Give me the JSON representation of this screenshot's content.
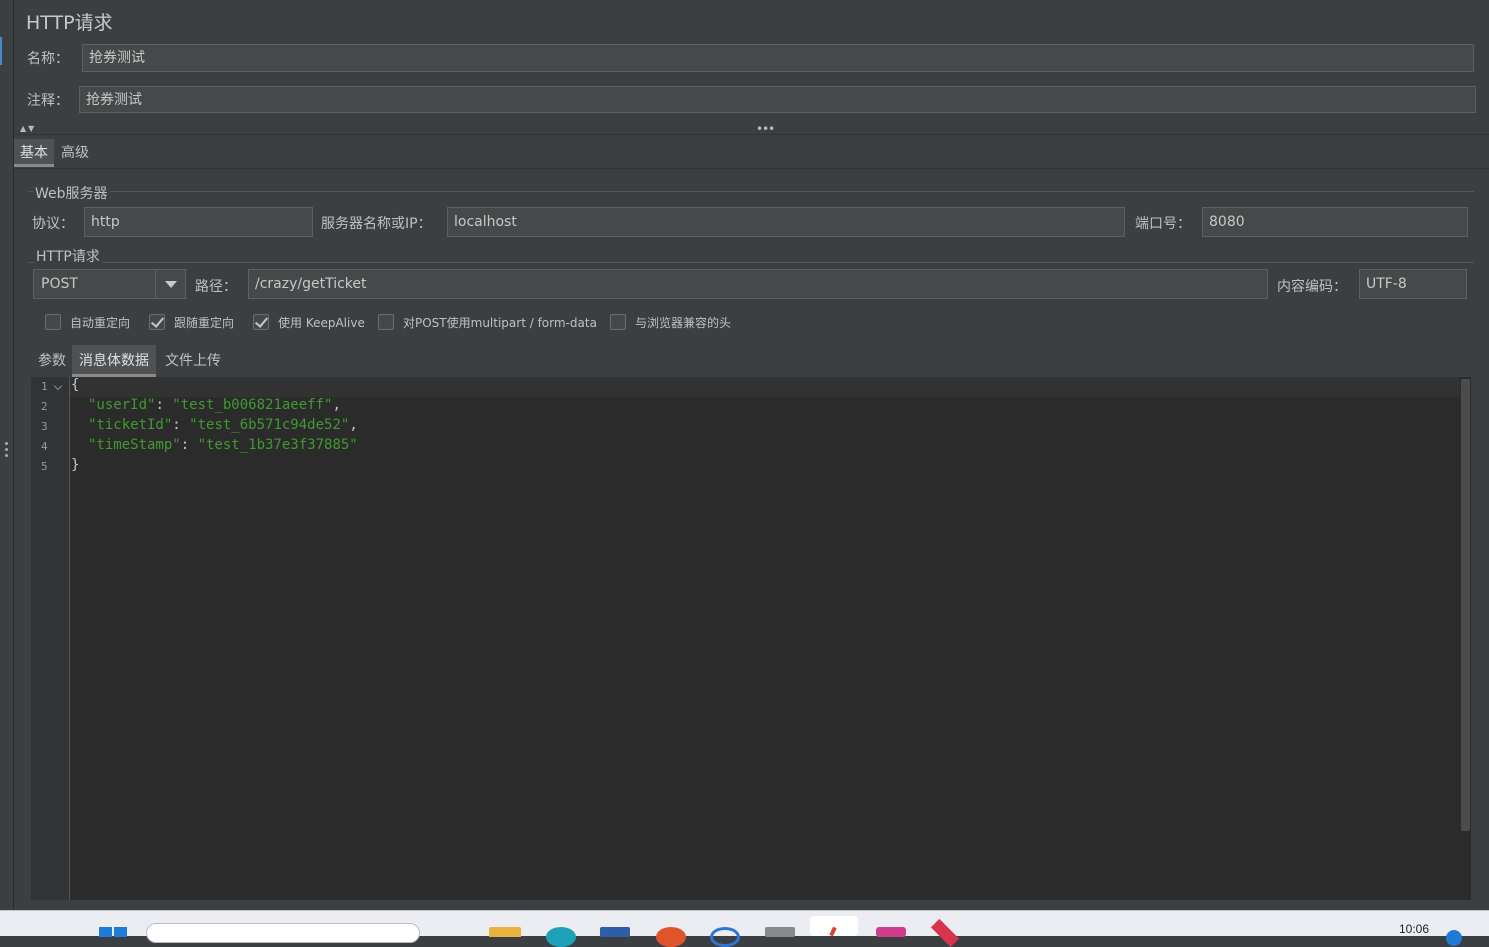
{
  "panel": {
    "title": "HTTP请求"
  },
  "form": {
    "name_label": "名称：",
    "name_value": "抢券测试",
    "comment_label": "注释：",
    "comment_value": "抢券测试"
  },
  "tabs": [
    {
      "label": "基本",
      "active": true
    },
    {
      "label": "高级",
      "active": false
    }
  ],
  "web_server": {
    "group_title": "Web服务器",
    "protocol_label": "协议：",
    "protocol_value": "http",
    "server_label": "服务器名称或IP：",
    "server_value": "localhost",
    "port_label": "端口号：",
    "port_value": "8080"
  },
  "http_request": {
    "group_title": "HTTP请求",
    "method_value": "POST",
    "path_label": "路径：",
    "path_value": "/crazy/getTicket",
    "encoding_label": "内容编码：",
    "encoding_value": "UTF-8"
  },
  "options": [
    {
      "label": "自动重定向",
      "checked": false
    },
    {
      "label": "跟随重定向",
      "checked": true
    },
    {
      "label": "使用 KeepAlive",
      "checked": true
    },
    {
      "label": "对POST使用multipart / form-data",
      "checked": false
    },
    {
      "label": "与浏览器兼容的头",
      "checked": false
    }
  ],
  "sub_tabs": [
    {
      "label": "参数",
      "active": false
    },
    {
      "label": "消息体数据",
      "active": true
    },
    {
      "label": "文件上传",
      "active": false
    }
  ],
  "editor": {
    "line_numbers": [
      "1",
      "2",
      "3",
      "4",
      "5"
    ],
    "open_brace": "{",
    "close_brace": "}",
    "lines": [
      {
        "key": "\"userId\"",
        "colon": ": ",
        "value": "\"test_b006821aeeff\"",
        "comma": ","
      },
      {
        "key": "\"ticketId\"",
        "colon": ": ",
        "value": "\"test_6b571c94de52\"",
        "comma": ","
      },
      {
        "key": "\"timeStamp\"",
        "colon": ": ",
        "value": "\"test_1b37e3f37885\"",
        "comma": ""
      }
    ]
  },
  "taskbar": {
    "clock": "10:06"
  },
  "colors": {
    "background": "#3c3f41",
    "editor_bg": "#2b2b2b",
    "json_string": "#3f9a2f",
    "accent": "#4a88c7"
  }
}
